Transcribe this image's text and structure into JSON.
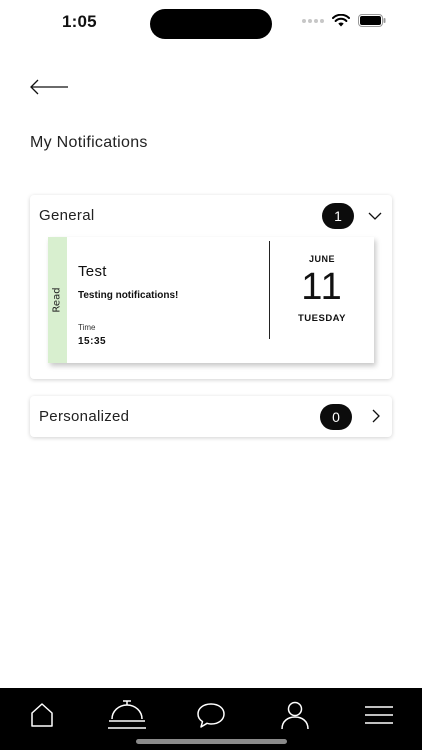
{
  "status_bar": {
    "time": "1:05"
  },
  "header": {
    "title": "My Notifications"
  },
  "sections": [
    {
      "label": "General",
      "count": "1",
      "expanded": true,
      "notifications": [
        {
          "status": "Read",
          "title": "Test",
          "message": "Testing notifications!",
          "time_label": "Time",
          "time": "15:35",
          "month": "JUNE",
          "day": "11",
          "weekday": "TUESDAY"
        }
      ]
    },
    {
      "label": "Personalized",
      "count": "0",
      "expanded": false
    }
  ],
  "tabbar": {
    "items": [
      "home-icon",
      "concierge-bell-icon",
      "chat-icon",
      "profile-icon",
      "menu-icon"
    ],
    "selected": "concierge-bell-icon"
  },
  "colors": {
    "read_strip": "#d8efcf",
    "badge": "#0c0c0c",
    "tabbar": "#000000"
  }
}
